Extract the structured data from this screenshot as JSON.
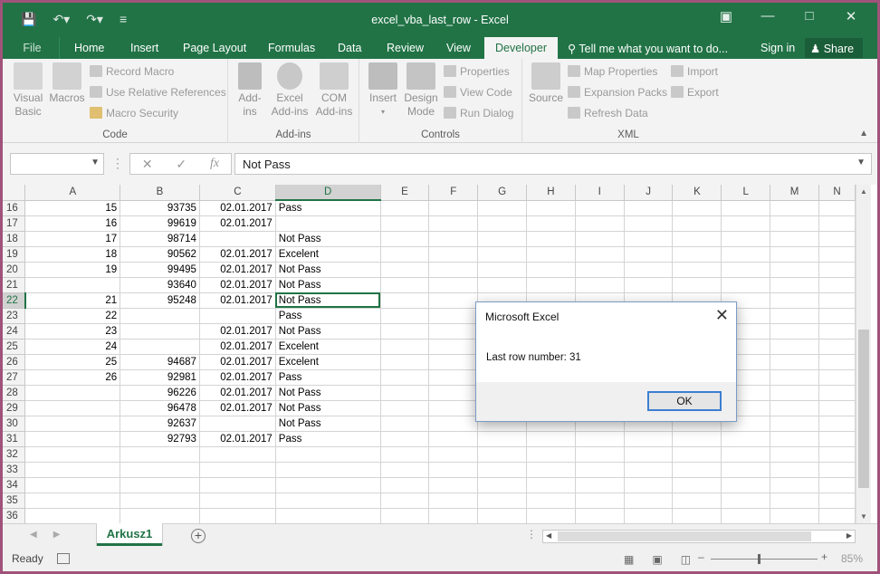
{
  "app": {
    "window_title": "excel_vba_last_row - Excel",
    "share_label": "Share",
    "signin_label": "Sign in",
    "tell_me": "Tell me what you want to do..."
  },
  "tabs": [
    "File",
    "Home",
    "Insert",
    "Page Layout",
    "Formulas",
    "Data",
    "Review",
    "View",
    "Developer"
  ],
  "ribbon": {
    "code": {
      "label": "Code",
      "visual_basic": "Visual Basic",
      "macros": "Macros",
      "record_macro": "Record Macro",
      "use_relative": "Use Relative References",
      "macro_security": "Macro Security"
    },
    "addins": {
      "label": "Add-ins",
      "addins": "Add-ins",
      "excel_addins": "Excel Add-ins",
      "com_addins": "COM Add-ins"
    },
    "controls": {
      "label": "Controls",
      "insert": "Insert",
      "design_mode": "Design Mode",
      "properties": "Properties",
      "view_code": "View Code",
      "run_dialog": "Run Dialog"
    },
    "xml": {
      "label": "XML",
      "source": "Source",
      "map_properties": "Map Properties",
      "expansion_packs": "Expansion Packs",
      "refresh_data": "Refresh Data",
      "import": "Import",
      "export": "Export"
    }
  },
  "formula_bar": {
    "name_box": "",
    "fx_label": "fx",
    "content": "Not Pass"
  },
  "columns": [
    "A",
    "B",
    "C",
    "D",
    "E",
    "F",
    "G",
    "H",
    "I",
    "J",
    "K",
    "L",
    "M",
    "N"
  ],
  "rows": [
    {
      "n": "16",
      "a": "15",
      "b": "93735",
      "c": "02.01.2017",
      "d": "Pass"
    },
    {
      "n": "17",
      "a": "16",
      "b": "99619",
      "c": "02.01.2017",
      "d": ""
    },
    {
      "n": "18",
      "a": "17",
      "b": "98714",
      "c": "",
      "d": "Not Pass"
    },
    {
      "n": "19",
      "a": "18",
      "b": "90562",
      "c": "02.01.2017",
      "d": "Excelent"
    },
    {
      "n": "20",
      "a": "19",
      "b": "99495",
      "c": "02.01.2017",
      "d": "Not Pass"
    },
    {
      "n": "21",
      "a": "",
      "b": "93640",
      "c": "02.01.2017",
      "d": "Not Pass"
    },
    {
      "n": "22",
      "a": "21",
      "b": "95248",
      "c": "02.01.2017",
      "d": "Not Pass"
    },
    {
      "n": "23",
      "a": "22",
      "b": "",
      "c": "",
      "d": "Pass"
    },
    {
      "n": "24",
      "a": "23",
      "b": "",
      "c": "02.01.2017",
      "d": "Not Pass"
    },
    {
      "n": "25",
      "a": "24",
      "b": "",
      "c": "02.01.2017",
      "d": "Excelent"
    },
    {
      "n": "26",
      "a": "25",
      "b": "94687",
      "c": "02.01.2017",
      "d": "Excelent"
    },
    {
      "n": "27",
      "a": "26",
      "b": "92981",
      "c": "02.01.2017",
      "d": "Pass"
    },
    {
      "n": "28",
      "a": "",
      "b": "96226",
      "c": "02.01.2017",
      "d": "Not Pass"
    },
    {
      "n": "29",
      "a": "",
      "b": "96478",
      "c": "02.01.2017",
      "d": "Not Pass"
    },
    {
      "n": "30",
      "a": "",
      "b": "92637",
      "c": "",
      "d": "Not Pass"
    },
    {
      "n": "31",
      "a": "",
      "b": "92793",
      "c": "02.01.2017",
      "d": "Pass"
    },
    {
      "n": "32",
      "a": "",
      "b": "",
      "c": "",
      "d": ""
    },
    {
      "n": "33",
      "a": "",
      "b": "",
      "c": "",
      "d": ""
    },
    {
      "n": "34",
      "a": "",
      "b": "",
      "c": "",
      "d": ""
    },
    {
      "n": "35",
      "a": "",
      "b": "",
      "c": "",
      "d": ""
    },
    {
      "n": "36",
      "a": "",
      "b": "",
      "c": "",
      "d": ""
    }
  ],
  "active_row": "22",
  "sheet_tab": "Arkusz1",
  "status": {
    "ready": "Ready",
    "zoom": "85%"
  },
  "dialog": {
    "title": "Microsoft Excel",
    "message": "Last row number: 31",
    "ok": "OK"
  },
  "colors": {
    "accent": "#217346",
    "frame": "#a0527a"
  }
}
